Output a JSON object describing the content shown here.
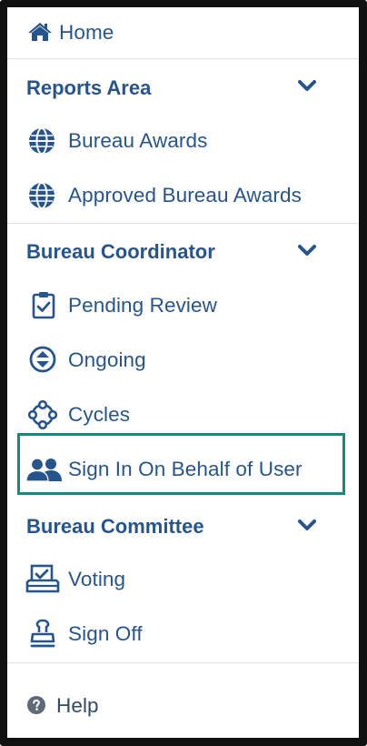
{
  "menu": {
    "home": {
      "label": "Home",
      "icon": "home-icon"
    },
    "reports": {
      "label": "Reports Area",
      "items": [
        {
          "label": "Bureau Awards",
          "icon": "globe-icon"
        },
        {
          "label": "Approved Bureau Awards",
          "icon": "globe-icon"
        }
      ]
    },
    "coordinator": {
      "label": "Bureau Coordinator",
      "items": [
        {
          "label": "Pending Review",
          "icon": "clipboard-check-icon"
        },
        {
          "label": "Ongoing",
          "icon": "sort-circle-icon"
        },
        {
          "label": "Cycles",
          "icon": "cycle-nodes-icon"
        },
        {
          "label": "Sign In On Behalf of User",
          "icon": "users-icon"
        }
      ]
    },
    "committee": {
      "label": "Bureau Committee",
      "items": [
        {
          "label": "Voting",
          "icon": "ballot-box-icon"
        },
        {
          "label": "Sign Off",
          "icon": "stamp-icon"
        }
      ]
    },
    "help": {
      "label": "Help",
      "icon": "question-circle-icon"
    }
  },
  "colors": {
    "text": "#26558d",
    "help_text": "#2f4a6b",
    "highlight_border": "#138a7e",
    "divider": "#e3e3e3",
    "frame": "#111111"
  }
}
